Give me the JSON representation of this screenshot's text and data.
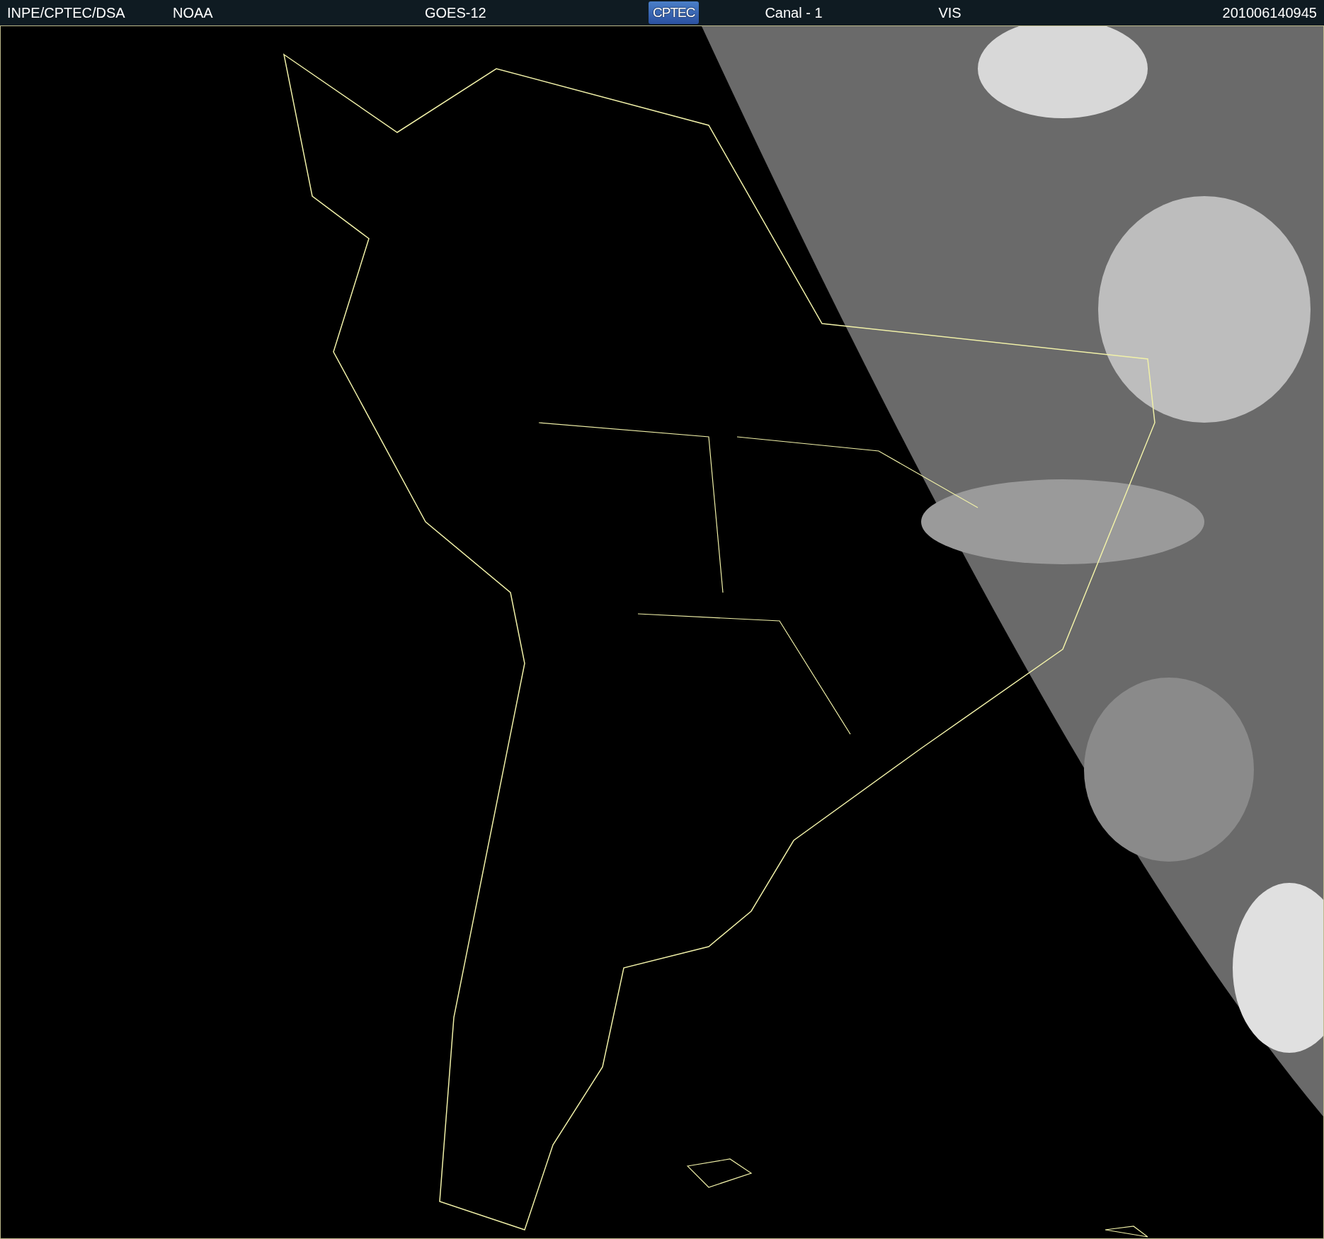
{
  "header": [
    {
      "kind": "text",
      "text": "INPE/CPTEC/DSA"
    },
    {
      "kind": "text",
      "text": "NOAA"
    },
    {
      "kind": "text",
      "text": "GOES-12"
    },
    {
      "kind": "logo",
      "text": "CPTEC"
    },
    {
      "kind": "text",
      "text": "Canal - 1"
    },
    {
      "kind": "text",
      "text": "VIS"
    },
    {
      "kind": "text",
      "text": "201006140945"
    }
  ]
}
